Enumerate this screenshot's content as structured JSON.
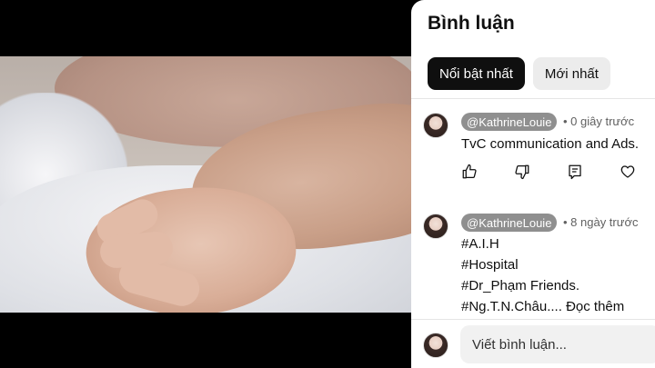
{
  "panel": {
    "title": "Bình luận",
    "chips": [
      {
        "label": "Nổi bật nhất",
        "active": true
      },
      {
        "label": "Mới nhất",
        "active": false
      }
    ]
  },
  "comments": [
    {
      "author": "@KathrineLouie",
      "time": "• 0 giây trước",
      "lines": [
        "TvC communication and Ads."
      ]
    },
    {
      "author": "@KathrineLouie",
      "time": "• 8 ngày trước",
      "lines": [
        "#A.I.H",
        "#Hospital",
        "#Dr_Phạm Friends.",
        "#Ng.T.N.Châu...."
      ],
      "more_label": "Đọc thêm"
    }
  ],
  "actions": {
    "like_icon": "thumbs-up-icon",
    "dislike_icon": "thumbs-down-icon",
    "reply_icon": "reply-icon",
    "heart_icon": "heart-icon"
  },
  "compose": {
    "placeholder": "Viết bình luận..."
  },
  "colors": {
    "chip_active_bg": "#0f0f0f",
    "chip_inactive_bg": "#ececec",
    "handle_bg": "#8f8f8f"
  }
}
